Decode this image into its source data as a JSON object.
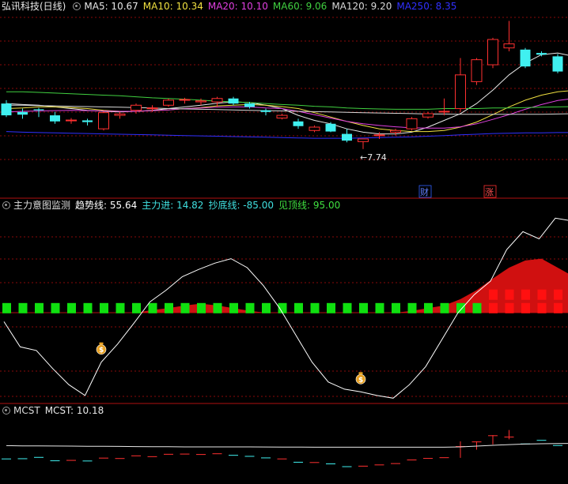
{
  "panel1": {
    "stock": "弘讯科技(日线)",
    "legend": [
      {
        "label": "MA5: 10.67",
        "color": "#e8e8e8"
      },
      {
        "label": "MA10: 10.34",
        "color": "#f0e040"
      },
      {
        "label": "MA20: 10.10",
        "color": "#e040e0"
      },
      {
        "label": "MA60: 9.06",
        "color": "#40d040"
      },
      {
        "label": "MA120: 9.20",
        "color": "#d8d8d8"
      },
      {
        "label": "MA250: 8.35",
        "color": "#3030ff"
      }
    ],
    "low_marker": "←7.74",
    "badge_cai": "财",
    "badge_zhang": "涨"
  },
  "panel2": {
    "name": "主力意图监测",
    "items": [
      {
        "label": "趋势线: 55.64",
        "color": "#ffffff"
      },
      {
        "label": "主力进: 14.82",
        "color": "#40e0e0"
      },
      {
        "label": "抄底线: -85.00",
        "color": "#40e0e0"
      },
      {
        "label": "见顶线: 95.00",
        "color": "#40e040"
      }
    ]
  },
  "panel3": {
    "name": "MCST",
    "items": [
      {
        "label": "MCST: 10.18",
        "color": "#e8e8e8"
      }
    ]
  },
  "colors": {
    "up": "#ff3030",
    "down": "#40f0f0",
    "grid": "#8a0a0a",
    "money": "#e8a020"
  },
  "chart_data": [
    {
      "type": "candlestick",
      "title": "弘讯科技(日线)",
      "ylim": [
        7.4,
        12.6
      ],
      "low_label": 7.74,
      "candles": [
        {
          "o": 9.95,
          "h": 10.05,
          "l": 9.55,
          "c": 9.6
        },
        {
          "o": 9.7,
          "h": 9.8,
          "l": 9.5,
          "c": 9.62
        },
        {
          "o": 9.78,
          "h": 9.82,
          "l": 9.55,
          "c": 9.75
        },
        {
          "o": 9.6,
          "h": 9.7,
          "l": 9.35,
          "c": 9.42
        },
        {
          "o": 9.45,
          "h": 9.52,
          "l": 9.35,
          "c": 9.46
        },
        {
          "o": 9.45,
          "h": 9.5,
          "l": 9.3,
          "c": 9.4
        },
        {
          "o": 9.2,
          "h": 9.72,
          "l": 9.15,
          "c": 9.68
        },
        {
          "o": 9.6,
          "h": 9.7,
          "l": 9.5,
          "c": 9.64
        },
        {
          "o": 9.75,
          "h": 9.95,
          "l": 9.65,
          "c": 9.9
        },
        {
          "o": 9.8,
          "h": 9.9,
          "l": 9.7,
          "c": 9.82
        },
        {
          "o": 9.9,
          "h": 10.1,
          "l": 9.85,
          "c": 10.05
        },
        {
          "o": 10.05,
          "h": 10.12,
          "l": 9.95,
          "c": 10.07
        },
        {
          "o": 10.0,
          "h": 10.1,
          "l": 9.9,
          "c": 10.03
        },
        {
          "o": 10.0,
          "h": 10.15,
          "l": 9.85,
          "c": 10.1
        },
        {
          "o": 10.1,
          "h": 10.15,
          "l": 9.9,
          "c": 9.95
        },
        {
          "o": 9.95,
          "h": 10.0,
          "l": 9.8,
          "c": 9.85
        },
        {
          "o": 9.75,
          "h": 9.8,
          "l": 9.6,
          "c": 9.7
        },
        {
          "o": 9.52,
          "h": 9.65,
          "l": 9.48,
          "c": 9.6
        },
        {
          "o": 9.42,
          "h": 9.5,
          "l": 9.2,
          "c": 9.28
        },
        {
          "o": 9.15,
          "h": 9.3,
          "l": 9.1,
          "c": 9.25
        },
        {
          "o": 9.35,
          "h": 9.4,
          "l": 9.1,
          "c": 9.12
        },
        {
          "o": 9.05,
          "h": 9.2,
          "l": 8.8,
          "c": 8.85
        },
        {
          "o": 8.82,
          "h": 8.9,
          "l": 8.6,
          "c": 8.9
        },
        {
          "o": 9.0,
          "h": 9.1,
          "l": 8.9,
          "c": 9.02
        },
        {
          "o": 9.1,
          "h": 9.2,
          "l": 9.0,
          "c": 9.15
        },
        {
          "o": 9.2,
          "h": 9.55,
          "l": 9.15,
          "c": 9.5
        },
        {
          "o": 9.55,
          "h": 9.7,
          "l": 9.5,
          "c": 9.65
        },
        {
          "o": 9.7,
          "h": 10.1,
          "l": 9.6,
          "c": 9.72
        },
        {
          "o": 9.8,
          "h": 11.3,
          "l": 9.7,
          "c": 10.8
        },
        {
          "o": 10.6,
          "h": 11.3,
          "l": 10.5,
          "c": 11.25
        },
        {
          "o": 11.1,
          "h": 11.9,
          "l": 11.0,
          "c": 11.85
        },
        {
          "o": 11.6,
          "h": 12.4,
          "l": 11.5,
          "c": 11.72
        },
        {
          "o": 11.55,
          "h": 11.6,
          "l": 11.0,
          "c": 11.05
        },
        {
          "o": 11.45,
          "h": 11.5,
          "l": 11.35,
          "c": 11.4
        },
        {
          "o": 11.35,
          "h": 11.42,
          "l": 10.85,
          "c": 10.9
        },
        {
          "o": 11.15,
          "h": 11.3,
          "l": 10.9,
          "c": 11.0
        }
      ],
      "series": [
        {
          "name": "MA5",
          "values": [
            9.95,
            9.92,
            9.9,
            9.85,
            9.8,
            9.75,
            9.72,
            9.7,
            9.72,
            9.75,
            9.8,
            9.85,
            9.9,
            9.96,
            10.0,
            9.98,
            9.9,
            9.8,
            9.6,
            9.45,
            9.35,
            9.2,
            9.1,
            9.05,
            9.05,
            9.1,
            9.25,
            9.45,
            9.65,
            9.95,
            10.35,
            10.8,
            11.15,
            11.4,
            11.45,
            11.35
          ]
        },
        {
          "name": "MA10",
          "values": [
            9.8,
            9.82,
            9.85,
            9.85,
            9.83,
            9.8,
            9.75,
            9.72,
            9.72,
            9.74,
            9.76,
            9.8,
            9.83,
            9.88,
            9.9,
            9.92,
            9.9,
            9.86,
            9.8,
            9.68,
            9.55,
            9.42,
            9.3,
            9.2,
            9.15,
            9.12,
            9.12,
            9.15,
            9.25,
            9.4,
            9.62,
            9.85,
            10.05,
            10.2,
            10.3,
            10.34
          ]
        },
        {
          "name": "MA20",
          "values": [
            9.7,
            9.72,
            9.73,
            9.74,
            9.75,
            9.74,
            9.73,
            9.72,
            9.72,
            9.74,
            9.76,
            9.8,
            9.82,
            9.84,
            9.85,
            9.85,
            9.82,
            9.8,
            9.72,
            9.62,
            9.52,
            9.42,
            9.35,
            9.3,
            9.26,
            9.23,
            9.22,
            9.22,
            9.26,
            9.35,
            9.48,
            9.62,
            9.78,
            9.92,
            10.04,
            10.1
          ]
        },
        {
          "name": "MA60",
          "values": [
            10.3,
            10.3,
            10.28,
            10.26,
            10.24,
            10.22,
            10.2,
            10.18,
            10.15,
            10.12,
            10.1,
            10.08,
            10.05,
            10.02,
            10.0,
            9.98,
            9.95,
            9.92,
            9.9,
            9.87,
            9.85,
            9.82,
            9.8,
            9.79,
            9.78,
            9.78,
            9.78,
            9.8,
            9.8,
            9.8,
            9.82,
            9.82,
            9.83,
            9.84,
            9.85,
            9.86
          ]
        },
        {
          "name": "MA120",
          "values": [
            9.9,
            9.9,
            9.89,
            9.88,
            9.87,
            9.86,
            9.85,
            9.84,
            9.83,
            9.82,
            9.8,
            9.79,
            9.78,
            9.77,
            9.76,
            9.75,
            9.74,
            9.73,
            9.72,
            9.71,
            9.7,
            9.69,
            9.68,
            9.67,
            9.66,
            9.65,
            9.64,
            9.64,
            9.63,
            9.63,
            9.63,
            9.63,
            9.63,
            9.63,
            9.64,
            9.65
          ]
        },
        {
          "name": "MA250",
          "values": [
            9.12,
            9.1,
            9.09,
            9.08,
            9.07,
            9.06,
            9.05,
            9.04,
            9.03,
            9.02,
            9.01,
            9.0,
            8.99,
            8.98,
            8.97,
            8.96,
            8.95,
            8.94,
            8.93,
            8.92,
            8.92,
            8.92,
            8.93,
            8.94,
            8.95,
            8.96,
            8.98,
            9.0,
            9.02,
            9.04,
            9.06,
            9.07,
            9.08,
            9.08,
            9.09,
            9.09
          ]
        }
      ]
    },
    {
      "type": "line",
      "title": "主力意图监测",
      "ylim": [
        -100,
        100
      ],
      "series": [
        {
          "name": "趋势线",
          "values": [
            -10,
            -38,
            -42,
            -62,
            -80,
            -92,
            -55,
            -35,
            -12,
            12,
            25,
            40,
            48,
            55,
            60,
            50,
            30,
            5,
            -25,
            -55,
            -77,
            -85,
            -88,
            -92,
            -95,
            -80,
            -60,
            -30,
            0,
            20,
            35,
            70,
            90,
            82,
            105,
            102
          ]
        },
        {
          "name": "主力进",
          "values": [
            0,
            0,
            0,
            0,
            0,
            0,
            0,
            0,
            0,
            3,
            5,
            8,
            10,
            8,
            5,
            2,
            0,
            0,
            0,
            0,
            0,
            0,
            0,
            0,
            0,
            2,
            5,
            8,
            15,
            25,
            38,
            50,
            58,
            60,
            50,
            40
          ]
        }
      ],
      "squares_y": 5,
      "squares_red_from_index": 30,
      "red_squares_y": 20,
      "money_bag_indices": [
        6,
        22
      ]
    },
    {
      "type": "line",
      "title": "MCST",
      "series": [
        {
          "name": "MCST",
          "values": [
            9.97,
            9.95,
            9.94,
            9.93,
            9.92,
            9.91,
            9.9,
            9.89,
            9.88,
            9.87,
            9.86,
            9.85,
            9.85,
            9.85,
            9.85,
            9.85,
            9.84,
            9.83,
            9.83,
            9.82,
            9.82,
            9.82,
            9.82,
            9.82,
            9.82,
            9.82,
            9.82,
            9.82,
            9.85,
            9.92,
            10.0,
            10.07,
            10.12,
            10.15,
            10.17,
            10.18
          ]
        }
      ]
    }
  ]
}
